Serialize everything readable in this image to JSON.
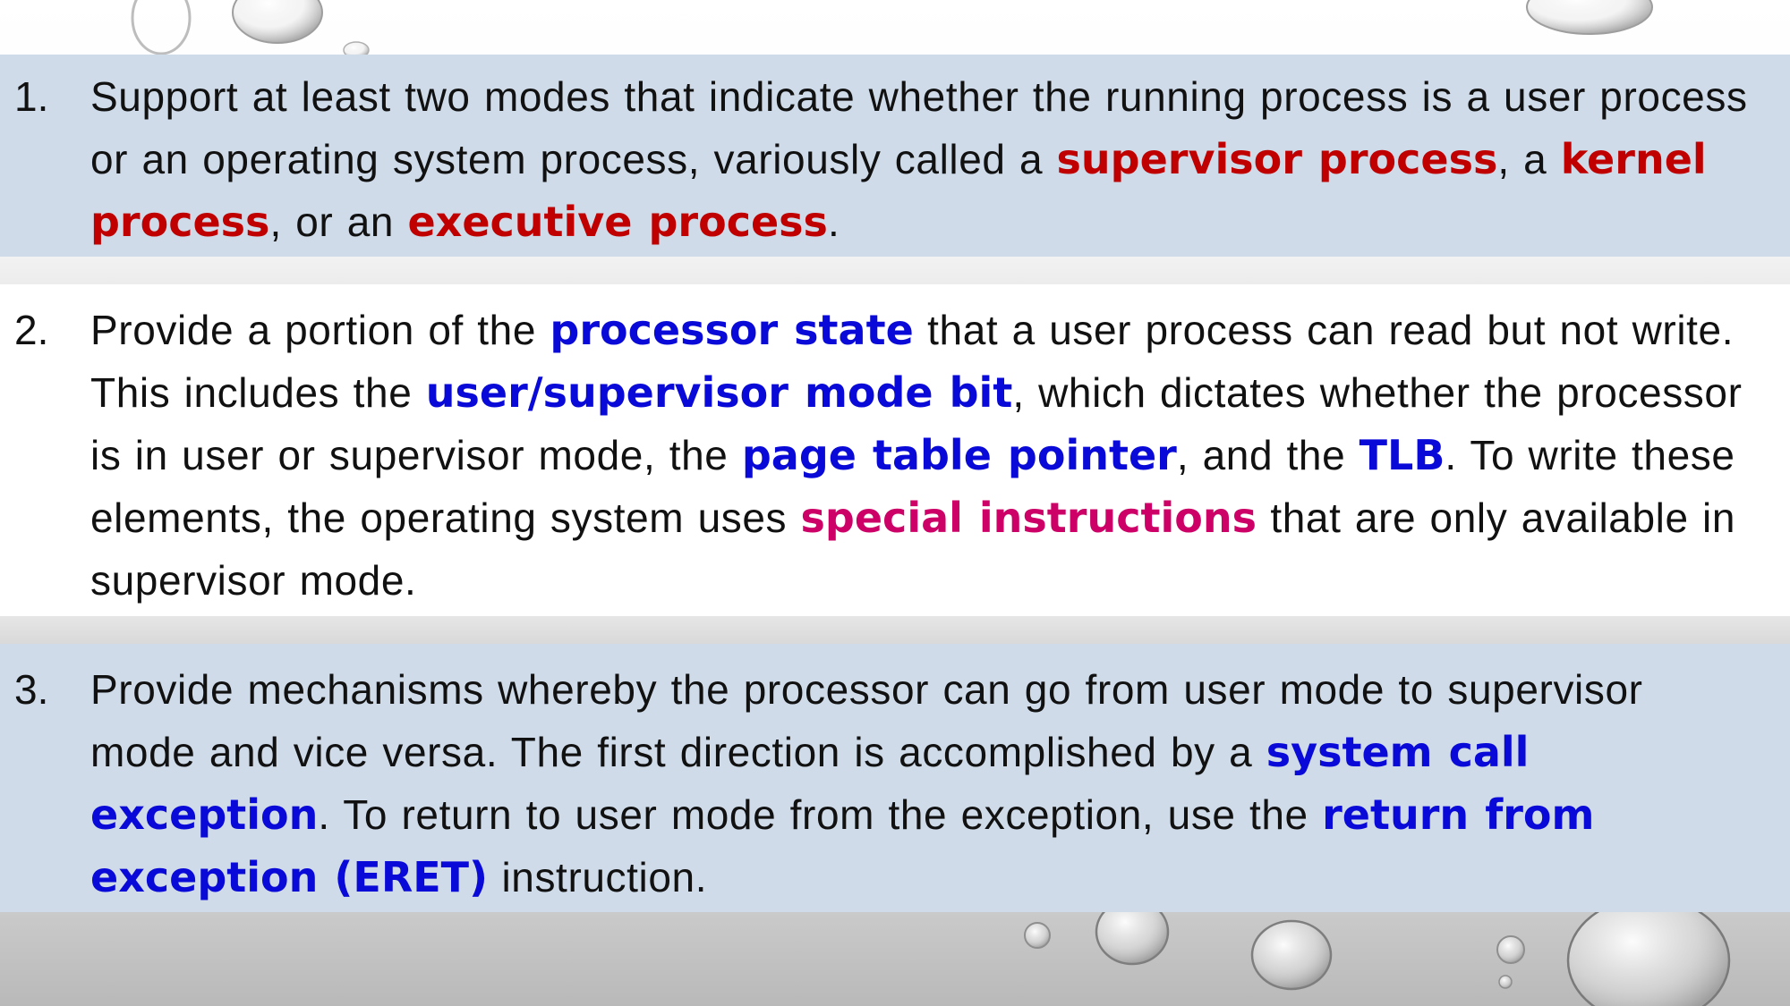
{
  "colors": {
    "band_blue": "#cfdbe9",
    "highlight_red": "#c00000",
    "highlight_blue": "#0a0ad8",
    "highlight_magenta": "#cc0066",
    "body_text": "#111111"
  },
  "items": [
    {
      "number": "1.",
      "segments": [
        {
          "text": "Support at least two modes that indicate whether the running process is a user process or an operating system process, variously called a ",
          "style": "plain"
        },
        {
          "text": "supervisor process",
          "style": "red"
        },
        {
          "text": ", a ",
          "style": "plain"
        },
        {
          "text": "kernel process",
          "style": "red"
        },
        {
          "text": ", or an ",
          "style": "plain"
        },
        {
          "text": "executive process",
          "style": "red"
        },
        {
          "text": ".",
          "style": "plain"
        }
      ]
    },
    {
      "number": "2.",
      "segments": [
        {
          "text": "Provide a portion of the ",
          "style": "plain"
        },
        {
          "text": "processor state",
          "style": "blue"
        },
        {
          "text": " that a user process can read but not write. This includes the ",
          "style": "plain"
        },
        {
          "text": "user/supervisor mode bit",
          "style": "blue"
        },
        {
          "text": ", which dictates whether the processor is in user or supervisor mode, the ",
          "style": "plain"
        },
        {
          "text": "page table pointer",
          "style": "blue"
        },
        {
          "text": ", and the ",
          "style": "plain"
        },
        {
          "text": "TLB",
          "style": "blue"
        },
        {
          "text": ". To write these elements, the operating system uses ",
          "style": "plain"
        },
        {
          "text": "special instructions",
          "style": "magenta"
        },
        {
          "text": " that are only available in supervisor mode.",
          "style": "plain"
        }
      ]
    },
    {
      "number": "3.",
      "segments": [
        {
          "text": "Provide mechanisms whereby the processor can go from user mode to supervisor mode and vice versa. The first direction is accomplished by a ",
          "style": "plain"
        },
        {
          "text": "system call exception",
          "style": "blue"
        },
        {
          "text": ". To return to user mode from the exception, use the ",
          "style": "plain"
        },
        {
          "text": "return from exception (ERET)",
          "style": "blue"
        },
        {
          "text": " instruction.",
          "style": "plain"
        }
      ]
    }
  ]
}
